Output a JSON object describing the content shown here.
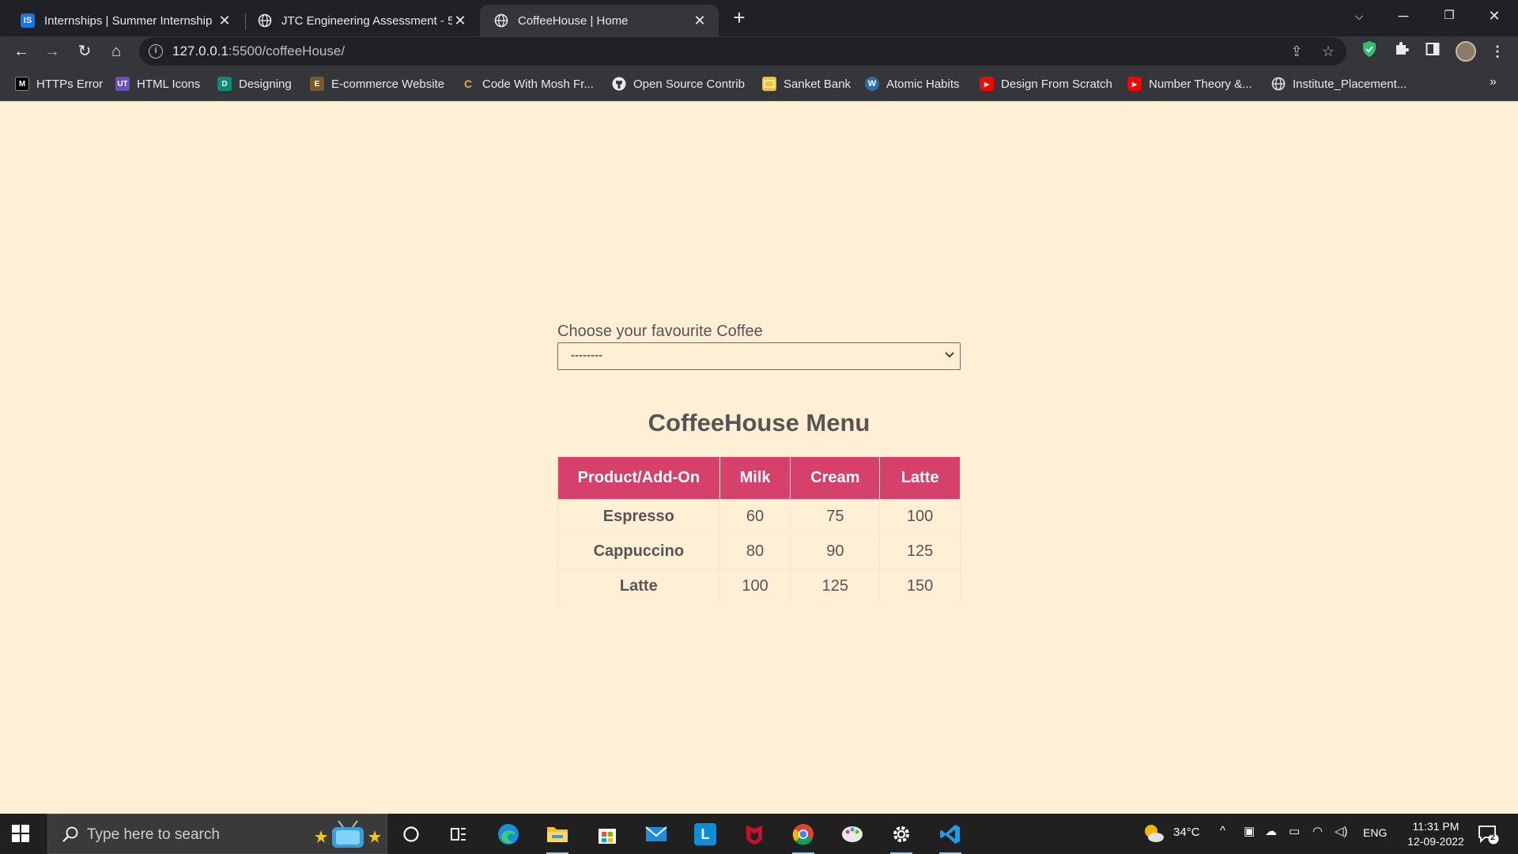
{
  "browser": {
    "tabs": [
      {
        "title": "Internships | Summer Internship",
        "favicon": "IS",
        "active": false
      },
      {
        "title": "JTC Engineering Assessment - 5.p",
        "favicon": "globe-icon",
        "active": false
      },
      {
        "title": "CoffeeHouse | Home",
        "favicon": "globe-icon",
        "active": true
      }
    ],
    "url": {
      "host": "127.0.0.1",
      "path": ":5500/coffeeHouse/"
    },
    "bookmarks": [
      {
        "label": "HTTPs Error",
        "icon": "M"
      },
      {
        "label": "HTML Icons",
        "icon": "UT"
      },
      {
        "label": "Designing",
        "icon": "D"
      },
      {
        "label": "E-commerce Website",
        "icon": "E"
      },
      {
        "label": "Code With Mosh Fr...",
        "icon": "C"
      },
      {
        "label": "Open Source Contrib",
        "icon": "github-icon"
      },
      {
        "label": "Sanket Bank",
        "icon": "folder-icon"
      },
      {
        "label": "Atomic Habits",
        "icon": "wordpress-icon"
      },
      {
        "label": "Design From Scratch",
        "icon": "youtube-icon"
      },
      {
        "label": "Number Theory &...",
        "icon": "youtube-icon"
      },
      {
        "label": "Institute_Placement...",
        "icon": "globe-icon"
      }
    ],
    "bookmarks_more": "»"
  },
  "page": {
    "select_label": "Choose your favourite Coffee",
    "select_value": "--------",
    "menu_title": "CoffeeHouse Menu",
    "table": {
      "headers": [
        "Product/Add-On",
        "Milk",
        "Cream",
        "Latte"
      ],
      "rows": [
        [
          "Espresso",
          "60",
          "75",
          "100"
        ],
        [
          "Cappuccino",
          "80",
          "90",
          "125"
        ],
        [
          "Latte",
          "100",
          "125",
          "150"
        ]
      ]
    },
    "colors": {
      "background": "#FFEFD5",
      "header": "#D6416B",
      "text": "#555555"
    }
  },
  "taskbar": {
    "search_placeholder": "Type here to search",
    "weather": "34°C",
    "language": "ENG",
    "time": "11:31 PM",
    "date": "12-09-2022",
    "notifications": "2"
  }
}
